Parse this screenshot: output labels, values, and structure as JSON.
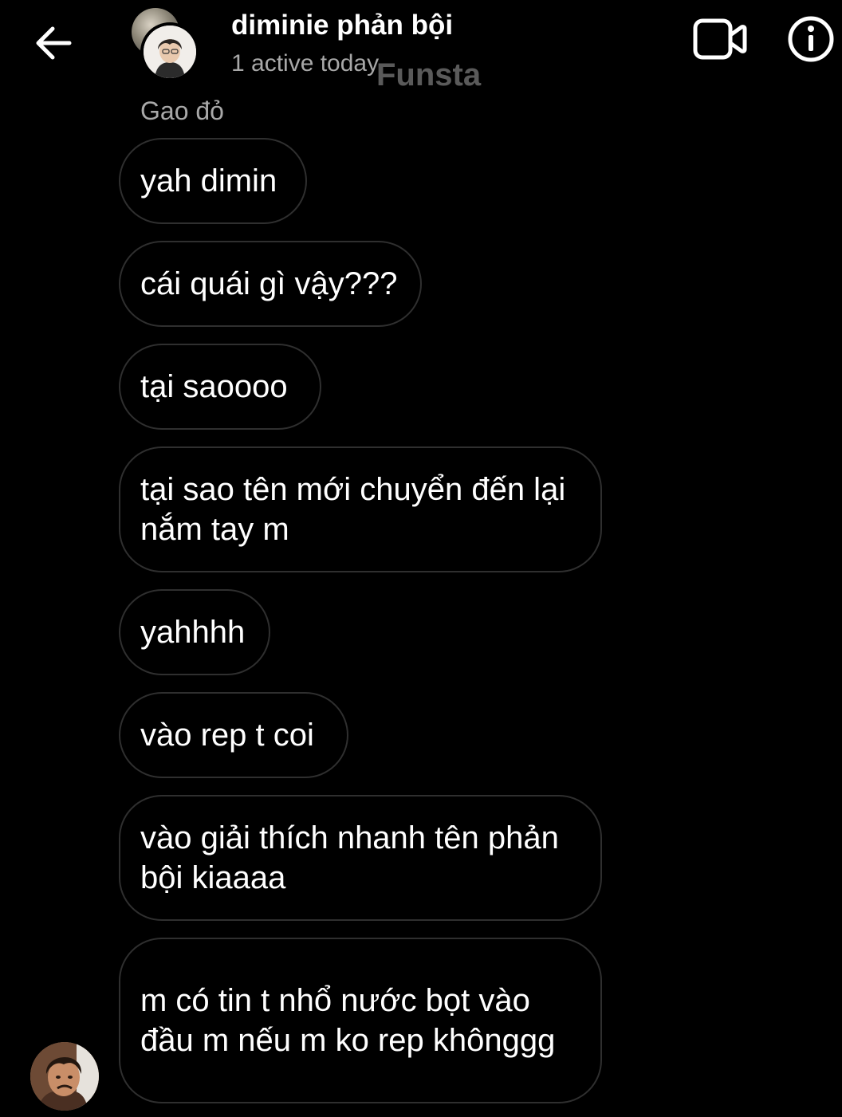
{
  "header": {
    "contact_name": "diminie phản bội",
    "status": "1 active today",
    "watermark": "Funsta"
  },
  "conversation": {
    "sender_name": "Gao đỏ",
    "messages": [
      "yah dimin",
      "cái quái gì vậy???",
      "tại saoooo",
      "tại sao tên mới chuyển đến lại nắm tay m",
      "yahhhh",
      "vào rep t coi",
      "vào giải thích nhanh tên phản bội kiaaaa",
      "m có tin t nhổ nước bọt vào đầu m nếu m ko rep khônggg"
    ]
  },
  "icons": {
    "back": "arrow-left-icon",
    "video": "video-camera-icon",
    "info": "info-circle-icon"
  },
  "colors": {
    "background": "#000000",
    "text": "#ffffff",
    "secondary_text": "#a8a8a8",
    "bubble_border": "#2f2f2f"
  }
}
